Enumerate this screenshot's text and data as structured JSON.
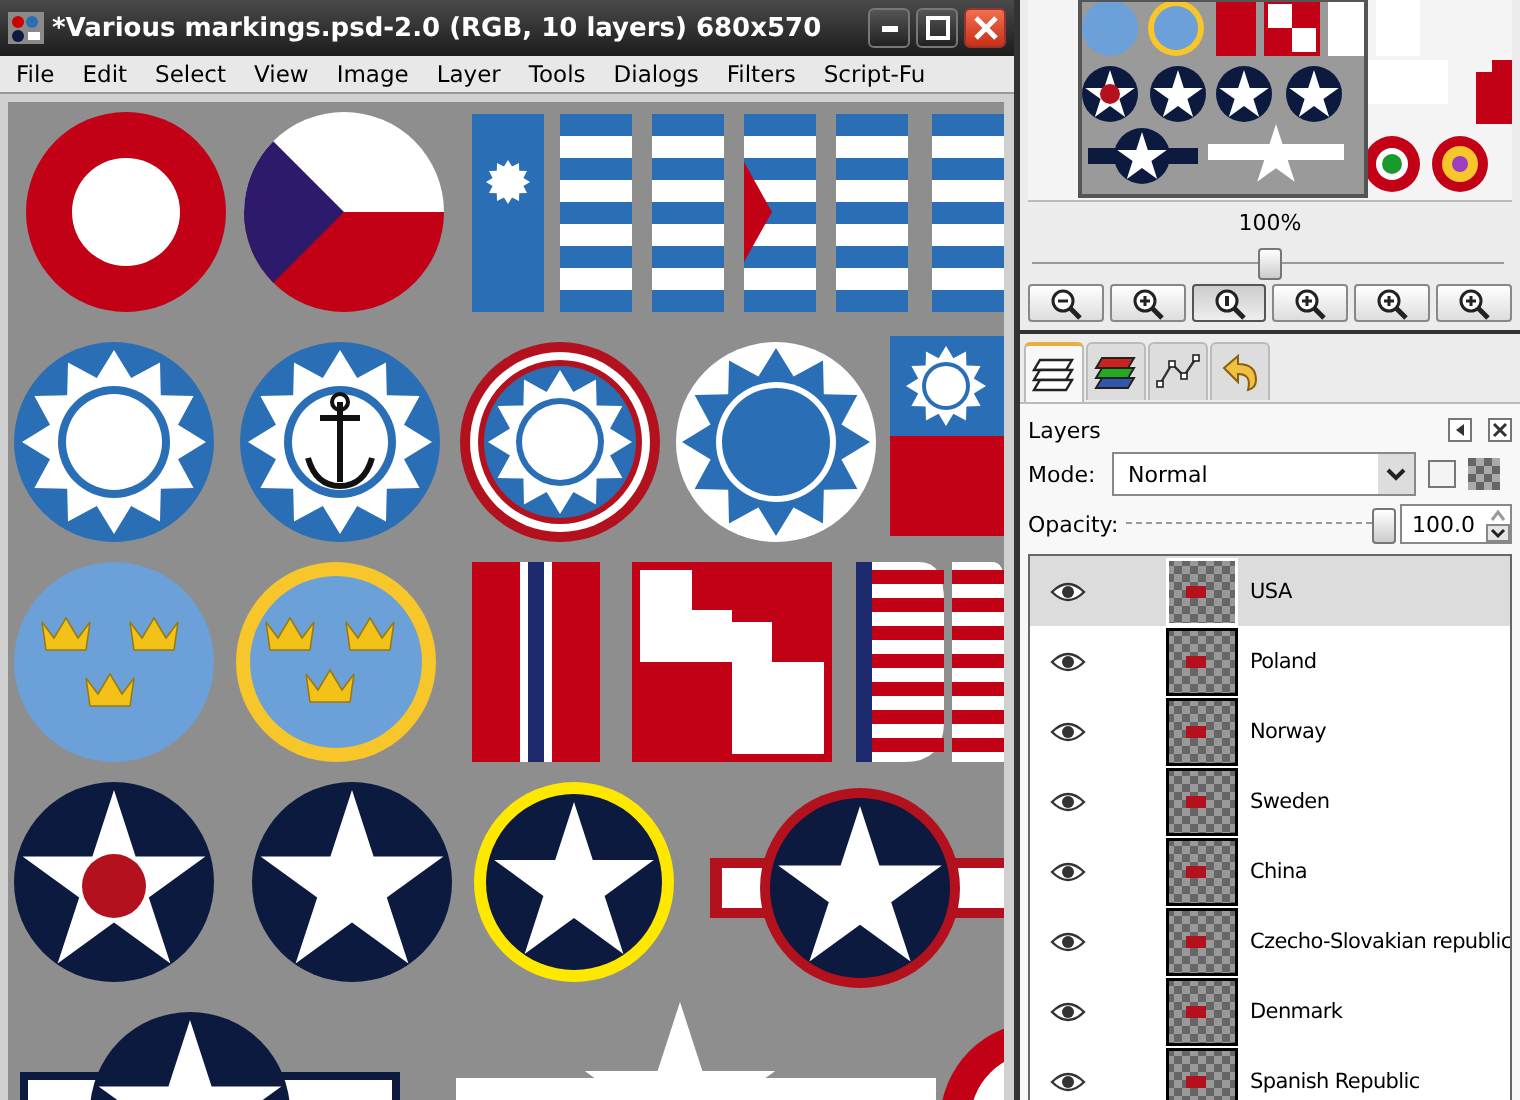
{
  "window": {
    "title": "*Various markings.psd-2.0 (RGB, 10 layers) 680x570"
  },
  "menu": [
    "File",
    "Edit",
    "Select",
    "View",
    "Image",
    "Layer",
    "Tools",
    "Dialogs",
    "Filters",
    "Script-Fu"
  ],
  "navigation": {
    "zoom": "100%",
    "zoom_slider": {
      "level": 0.5
    },
    "zoom_buttons": [
      {
        "kind": "zoom-out",
        "selected": false
      },
      {
        "kind": "zoom-in",
        "selected": false
      },
      {
        "kind": "zoom-one",
        "selected": true
      },
      {
        "kind": "zoom-in",
        "selected": false
      },
      {
        "kind": "zoom-in",
        "selected": false
      },
      {
        "kind": "zoom-in",
        "selected": false
      }
    ]
  },
  "dock_tabs": [
    {
      "kind": "layers",
      "selected": true
    },
    {
      "kind": "channels",
      "selected": false
    },
    {
      "kind": "paths",
      "selected": false
    },
    {
      "kind": "undo",
      "selected": false
    }
  ],
  "layers_dialog": {
    "title": "Layers",
    "mode_label": "Mode:",
    "mode": "Normal",
    "opacity_label": "Opacity:",
    "opacity": {
      "level": 1.0
    },
    "opacity_value": "100.0",
    "layers": [
      {
        "name": "USA",
        "visible": true,
        "selected": true
      },
      {
        "name": "Poland",
        "visible": true,
        "selected": false
      },
      {
        "name": "Norway",
        "visible": true,
        "selected": false
      },
      {
        "name": "Sweden",
        "visible": true,
        "selected": false
      },
      {
        "name": "China",
        "visible": true,
        "selected": false
      },
      {
        "name": "Czecho-Slovakian republic",
        "visible": true,
        "selected": false
      },
      {
        "name": "Denmark",
        "visible": true,
        "selected": false
      },
      {
        "name": "Spanish Republic",
        "visible": true,
        "selected": false
      }
    ]
  }
}
